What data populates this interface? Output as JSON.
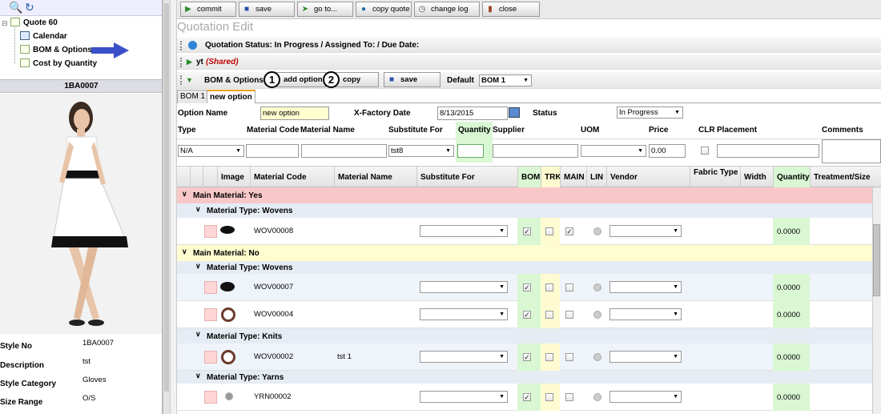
{
  "left": {
    "tree": {
      "root": "Quote 60",
      "items": [
        "Calendar",
        "BOM & Options",
        "Cost by Quantity"
      ]
    },
    "thumb_title": "1BA0007",
    "properties": [
      {
        "label": "Style No",
        "value": "1BA0007"
      },
      {
        "label": "Description",
        "value": "tst"
      },
      {
        "label": "Style Category",
        "value": "Gloves"
      },
      {
        "label": "Size Range",
        "value": "O/S"
      }
    ]
  },
  "toolbar": {
    "buttons": [
      "commit",
      "save",
      "go to...",
      "copy quote",
      "change log",
      "close"
    ]
  },
  "page_title": "Quotation Edit",
  "sections": {
    "status": "Quotation Status: In Progress / Assigned To: / Due Date:",
    "yt": "yt",
    "yt_shared": "(Shared)",
    "bom": "BOM & Options",
    "add_option": "add option",
    "copy": "copy",
    "save": "save",
    "default_label": "Default",
    "default_value": "BOM 1"
  },
  "callouts": [
    "1",
    "2"
  ],
  "tabs": [
    "BOM 1",
    "new option"
  ],
  "option_form": {
    "option_name_label": "Option Name",
    "option_name_value": "new option",
    "xfactory_label": "X-Factory Date",
    "xfactory_value": "8/13/2015",
    "status_label": "Status",
    "status_value": "In Progress"
  },
  "entry_headers": [
    "Type",
    "Material Code",
    "Material Name",
    "Substitute For",
    "Quantity",
    "Supplier",
    "UOM",
    "Price",
    "CLR",
    "Placement",
    "Comments"
  ],
  "entry_values": {
    "type": "N/A",
    "substitute": "tst8",
    "price": "0.00"
  },
  "grid": {
    "headers": [
      "Image",
      "Material Code",
      "Material Name",
      "Substitute For",
      "BOM",
      "TRK",
      "MAIN",
      "LIN",
      "Vendor",
      "Fabric Type",
      "Width",
      "Quantity",
      "Treatment/Size"
    ],
    "groups": [
      {
        "title": "Main Material: Yes",
        "subgroups": [
          {
            "title": "Material Type: Wovens",
            "rows": [
              {
                "code": "WOV00008",
                "name": "",
                "bom": true,
                "main": true,
                "qty": "0.0000"
              }
            ]
          }
        ]
      },
      {
        "title": "Main Material: No",
        "subgroups": [
          {
            "title": "Material Type: Wovens",
            "rows": [
              {
                "code": "WOV00007",
                "name": "",
                "bom": true,
                "main": false,
                "qty": "0.0000"
              },
              {
                "code": "WOV00004",
                "name": "",
                "bom": true,
                "main": false,
                "qty": "0.0000"
              }
            ]
          },
          {
            "title": "Material Type: Knits",
            "rows": [
              {
                "code": "WOV00002",
                "name": "tst 1",
                "bom": true,
                "main": false,
                "qty": "0.0000"
              }
            ]
          },
          {
            "title": "Material Type: Yarns",
            "rows": [
              {
                "code": "YRN00002",
                "name": "",
                "bom": true,
                "main": false,
                "qty": "0.0000"
              }
            ]
          }
        ]
      }
    ]
  },
  "colors": {
    "main_yes_bg": "#f8c8c8",
    "main_no_bg": "#fdfdd0",
    "subgroup_bg": "#e6ecf4",
    "bom_col": "#d9f7d3",
    "trk_col": "#fffbd0",
    "arrow": "#3a4fc8"
  }
}
